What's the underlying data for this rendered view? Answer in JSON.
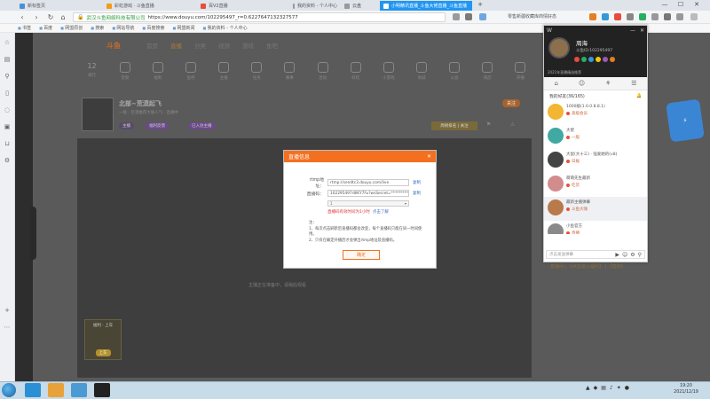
{
  "browser": {
    "tabs": [
      {
        "label": "新标签页",
        "color": "#4a90d9",
        "active": false
      },
      {
        "label": "彩虹游戏 · 斗鱼直播",
        "color": "#f39c12",
        "active": false
      },
      {
        "label": "百V2直播",
        "color": "#e74c3c",
        "active": false
      },
      {
        "label": "我的资料 - 个人中心",
        "color": "#999999",
        "active": false
      },
      {
        "label": "云盘",
        "color": "#999999",
        "active": false
      },
      {
        "label": "小明精讯直播_斗鱼大佬直播_斗鱼直播",
        "color": "#ffffff",
        "active": true
      }
    ],
    "new_tab": "+",
    "window_controls": {
      "minimize": "—",
      "maximize": "☐",
      "close": "✕"
    },
    "url_secure": "武汉斗鱼网络科技有限公司",
    "url": "https://www.douyu.com/102295497_r=0.6227647132327577",
    "search_hint": "零售新疆收藏库商情好态",
    "bookmarks": [
      "书签",
      "百度",
      "网盟原创",
      "搜索",
      "网站导航",
      "百度搜索",
      "网盟新闻",
      "我的资料 - 个人中心"
    ]
  },
  "site": {
    "logo": "斗鱼",
    "nav": [
      "首页",
      "直播",
      "分类",
      "视频",
      "游戏",
      "鱼吧"
    ],
    "categories": [
      "12",
      "排行",
      "音频",
      "福利",
      "鱼吧",
      "主播",
      "任务",
      "赛事",
      "活动",
      "好玩",
      "小游戏",
      "商城",
      "公会",
      "商店",
      "开播"
    ],
    "room_title": "北部~荒漠起飞",
    "room_sub": "一级 · 荒漠推荐大咖人气 · 直播中",
    "room_tags": [
      "主播",
      "福利反馈",
      "已入驻主播"
    ],
    "follow_label": "关注",
    "rank_label": "周榜排名 | 关注",
    "player_message": "主播正在准备中，请稍后观看",
    "gift_box_title": "福利 · 上车",
    "gift_box_btn": "上车",
    "right_link": "直播间 | 【点击进入福利】 | 【签到】"
  },
  "dialog": {
    "title": "直播信息",
    "close": "✕",
    "rtmp_label": "rtmp地址：",
    "rtmp_value": "rtmp://sendtc3.douyu.com/live",
    "copy1": "复制",
    "code_label": "直播码：",
    "code_value": "102295497r8lKY7Fu?wsSecret=*************",
    "copy2": "复制",
    "select_value": "1",
    "warning": "直播码有效时间为1小时",
    "warning_link": "点击了解",
    "notes_title": "注：",
    "note1": "1、每次点击刷新后直播码都会改变，每个直播码只能在同一时间使用。",
    "note2": "2、只有在确定开播后才会弹出rtmp地址及直播码。",
    "ok_label": "确定"
  },
  "chat": {
    "header_w": "W",
    "anchor_name": "周海",
    "anchor_id": "斗鱼ID:102295497",
    "header_footer": "2021年直播精选推荐",
    "tabs": [
      "⌂",
      "☺",
      "⚘",
      "☰"
    ],
    "notice": "我的好友(36/165)",
    "messages": [
      {
        "name": "1000级(1.0.0.8.8.1)",
        "msg": "高级会员",
        "avatar": "#f2b632"
      },
      {
        "name": "大佬",
        "msg": "一般",
        "avatar": "#3fa9a2"
      },
      {
        "name": "大鼠(大十三) · 强爱她的(v8)",
        "msg": "日报",
        "avatar": "#444444"
      },
      {
        "name": "萌萌先生最新",
        "msg": "吃货",
        "avatar": "#d28c8c"
      },
      {
        "name": "最新主播弹幕",
        "msg": "斗鱼大咖",
        "avatar": "#b87a4b"
      },
      {
        "name": "小鱼官方",
        "msg": "直播",
        "avatar": "#8a8a8a"
      }
    ],
    "input_placeholder": "点击发送弹幕"
  },
  "taskbar": {
    "clock_time": "19:20",
    "clock_date": "2021/12/19"
  }
}
